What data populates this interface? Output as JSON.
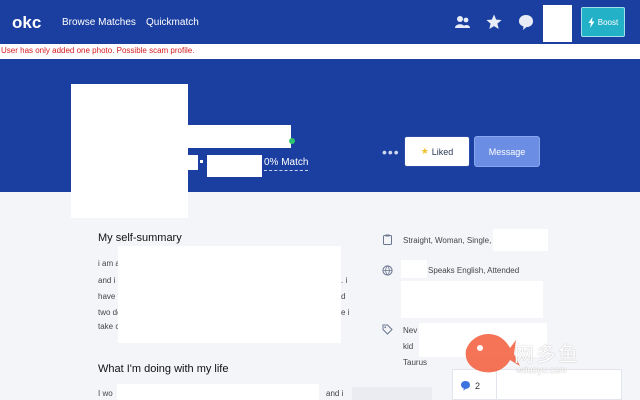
{
  "nav": {
    "logo": "okc",
    "links": [
      "Browse Matches",
      "Quickmatch"
    ],
    "boost_label": "Boost",
    "icons": [
      "people-icon",
      "star-icon",
      "chat-bubble-icon",
      "lightning-icon"
    ]
  },
  "warning": "User has only added one photo. Possible scam profile.",
  "profile": {
    "match": "0% Match",
    "more": "•••",
    "liked_label": "Liked",
    "message_label": "Message"
  },
  "self_summary": {
    "heading": "My self-summary",
    "lines_left": [
      "i am a",
      "and i l",
      "have t",
      "two do",
      "take c"
    ],
    "lines_right": [
      "",
      ". i",
      "d",
      "e i"
    ]
  },
  "doing": {
    "heading": "What I'm doing with my life",
    "line_left": "I wo",
    "line_right": "and i"
  },
  "details": {
    "basics": "Straight, Woman, Single,",
    "background": "Speaks English, Attended",
    "misc_a": "Nev",
    "misc_b": "kid",
    "sign": "Taurus"
  },
  "messages_count": "2",
  "watermark": {
    "text": "网多鱼",
    "url": "wduoyu.com"
  },
  "colors": {
    "brand": "#1b3fa0",
    "boost": "#23b1c8",
    "message": "#6b8de4",
    "warning": "#d3191c"
  }
}
